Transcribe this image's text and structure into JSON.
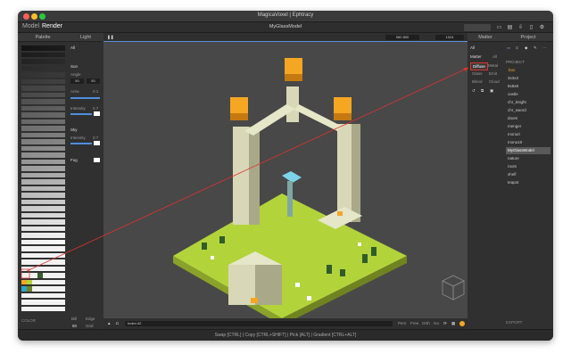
{
  "window": {
    "title": "MagicaVoxel | Ephtracy"
  },
  "modes": {
    "model": "Model",
    "render": "Render"
  },
  "filename": "MyGlassModel",
  "toolbar": {
    "button1": "",
    "button2": ""
  },
  "palette_panel": {
    "title": "Palette",
    "footer": "COLOR"
  },
  "light_panel": {
    "title": "Light",
    "tabs": [
      "All"
    ],
    "sun_label": "Sun",
    "angle_label": "Angle",
    "angle_values": [
      "50",
      "50"
    ],
    "area_label": "Area",
    "area_value": "0.1",
    "intensity_label": "Intensity",
    "intensity_value": "0.7",
    "sky_label": "Sky",
    "sky_intensity_label": "Intensity",
    "sky_intensity_value": "0.7",
    "fog_label": "Fog",
    "bottom_buttons": {
      "a": "Bill",
      "b": "Edge",
      "c": "60",
      "d": "Grid"
    }
  },
  "viewport": {
    "size_w": "960",
    "size_h": "800",
    "samples": "1024",
    "index_label": "Index:42",
    "cams": [
      "Pers",
      "Free",
      "Orth",
      "Iso"
    ]
  },
  "matter_panel": {
    "title": "Matter",
    "sub_title": "Matter",
    "sub_all": "All",
    "materials": [
      "Diffuse",
      "Metal",
      "Glass",
      "Emit",
      "Blend",
      "Cloud"
    ]
  },
  "project_panel": {
    "title": "Project",
    "section": "PROJECT",
    "folder": "box",
    "items": [
      "3x3x3",
      "8x8x8",
      "castle",
      "chr_knight",
      "chr_sword",
      "doom",
      "menger",
      "monu0",
      "monu10",
      "MyGlassModel",
      "nature",
      "room",
      "shelf",
      "teapot"
    ],
    "selected": "MyGlassModel",
    "footer": "EXPORT"
  },
  "status_bar": {
    "hint": "Swap [CTRL] | Copy [CTRL+SHIFT] | Pick [ALT] | Gradient [CTRL+ALT]"
  },
  "colors": {
    "accent": "#4d8fe0",
    "selection": "#e0322e",
    "grass": "#b3d33b"
  }
}
